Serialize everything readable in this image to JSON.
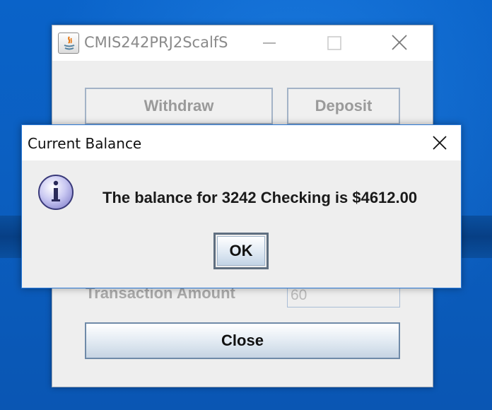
{
  "main_window": {
    "title": "CMIS242PRJ2ScalfS",
    "buttons": {
      "withdraw": "Withdraw",
      "deposit": "Deposit",
      "close": "Close"
    },
    "transaction_amount_label": "Transaction Amount",
    "transaction_amount_value": "60"
  },
  "dialog": {
    "title": "Current Balance",
    "message": "The balance for 3242 Checking is $4612.00",
    "ok_label": "OK",
    "icon": "info-icon"
  },
  "colors": {
    "desktop": "#0a5fc4",
    "dialog_border": "#2b79d6",
    "window_bg": "#eeeeee"
  }
}
